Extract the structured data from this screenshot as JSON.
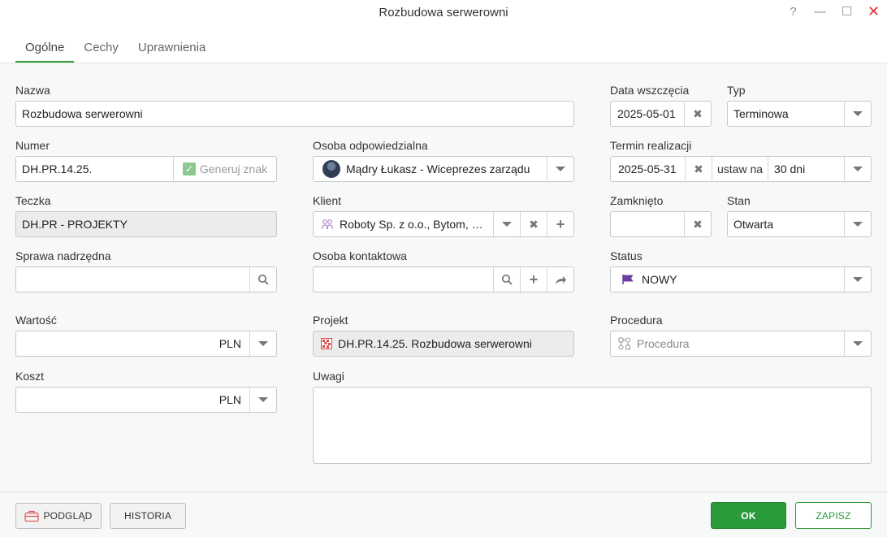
{
  "window": {
    "title": "Rozbudowa serwerowni",
    "help": "?",
    "minimize": "—",
    "maximize": "☐",
    "close": "✕"
  },
  "tabs": [
    "Ogólne",
    "Cechy",
    "Uprawnienia"
  ],
  "form": {
    "nazwa": {
      "label": "Nazwa",
      "value": "Rozbudowa serwerowni"
    },
    "numer": {
      "label": "Numer",
      "value": "DH.PR.14.25.",
      "generate": "Generuj znak"
    },
    "teczka": {
      "label": "Teczka",
      "value": "DH.PR - PROJEKTY"
    },
    "sprawa": {
      "label": "Sprawa nadrzędna",
      "value": ""
    },
    "wartosc": {
      "label": "Wartość",
      "currency": "PLN"
    },
    "koszt": {
      "label": "Koszt",
      "currency": "PLN"
    },
    "osoba_odp": {
      "label": "Osoba odpowiedzialna",
      "value": "Mądry Łukasz - Wiceprezes zarządu"
    },
    "klient": {
      "label": "Klient",
      "value": "Roboty Sp. z o.o., Bytom, K..."
    },
    "osoba_kontaktowa": {
      "label": "Osoba kontaktowa",
      "value": ""
    },
    "projekt": {
      "label": "Projekt",
      "value": "DH.PR.14.25. Rozbudowa serwerowni"
    },
    "uwagi": {
      "label": "Uwagi",
      "value": ""
    },
    "data_wszczecia": {
      "label": "Data wszczęcia",
      "value": "2025-05-01"
    },
    "typ": {
      "label": "Typ",
      "value": "Terminowa"
    },
    "termin": {
      "label": "Termin realizacji",
      "value": "2025-05-31",
      "set_label": "ustaw na",
      "days": "30 dni"
    },
    "zamknieto": {
      "label": "Zamknięto",
      "value": ""
    },
    "stan": {
      "label": "Stan",
      "value": "Otwarta"
    },
    "status": {
      "label": "Status",
      "value": "NOWY",
      "flag_color": "#6b3fa0"
    },
    "procedura": {
      "label": "Procedura",
      "placeholder": "Procedura"
    }
  },
  "footer": {
    "preview": "PODGLĄD",
    "history": "HISTORIA",
    "ok": "OK",
    "save": "ZAPISZ"
  },
  "colors": {
    "accent": "#2b9a3a",
    "close": "#d33333"
  }
}
